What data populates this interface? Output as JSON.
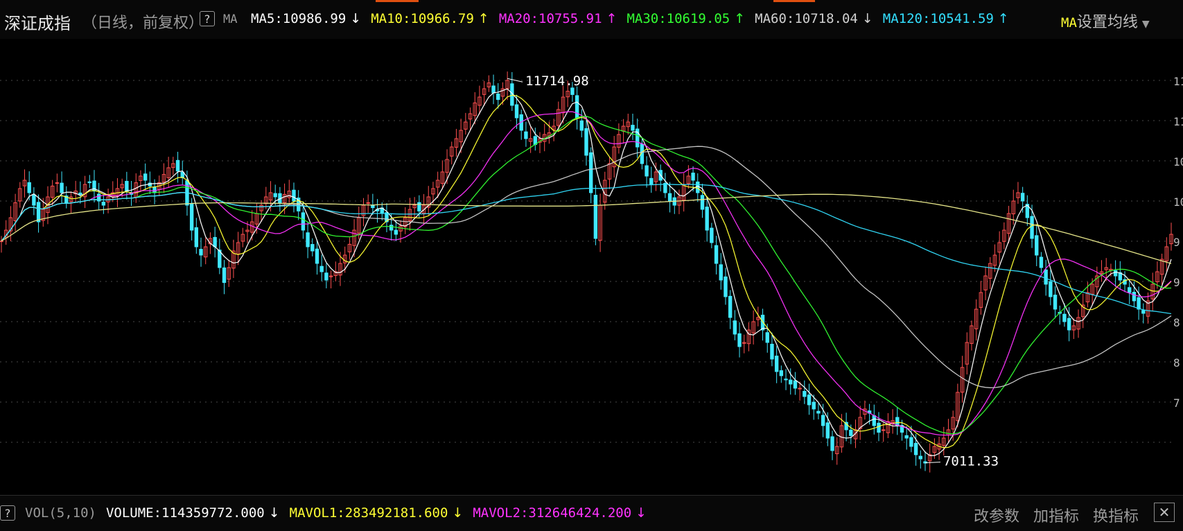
{
  "header": {
    "title": "深证成指",
    "subtitle": "（日线，前复权）",
    "help_label": "?",
    "indicator_name": "MA",
    "ma_items": [
      {
        "label": "MA5:10986.99",
        "arrow": "↓",
        "color": "#ffffff"
      },
      {
        "label": "MA10:10966.79",
        "arrow": "↑",
        "color": "#ffff33"
      },
      {
        "label": "MA20:10755.91",
        "arrow": "↑",
        "color": "#ff33ff"
      },
      {
        "label": "MA30:10619.05",
        "arrow": "↑",
        "color": "#33ff33"
      },
      {
        "label": "MA60:10718.04",
        "arrow": "↓",
        "color": "#cfcfcf"
      },
      {
        "label": "MA120:10541.59",
        "arrow": "↑",
        "color": "#33dfff"
      }
    ],
    "ma_settings_label": "设置均线",
    "ma_settings_prefix": "MA"
  },
  "chart_data": {
    "type": "candlestick",
    "y_range": [
      6900,
      11900
    ],
    "annotations": [
      {
        "label": "11714.98",
        "value": 11714.98,
        "kind": "high"
      },
      {
        "label": "7011.33",
        "value": 7011.33,
        "kind": "low"
      }
    ],
    "close": [
      9720,
      9850,
      10000,
      10180,
      10350,
      10450,
      10300,
      10150,
      9950,
      10100,
      10250,
      10380,
      10420,
      10300,
      10180,
      10250,
      10320,
      10280,
      10400,
      10420,
      10320,
      10200,
      10150,
      10250,
      10300,
      10350,
      10400,
      10320,
      10280,
      10420,
      10500,
      10450,
      10380,
      10300,
      10420,
      10520,
      10600,
      10650,
      10560,
      10480,
      10150,
      9850,
      9650,
      9550,
      9650,
      9750,
      9650,
      9400,
      9220,
      9400,
      9600,
      9700,
      9800,
      9850,
      9950,
      10050,
      10150,
      10250,
      10300,
      10250,
      10180,
      10280,
      10320,
      10200,
      10080,
      9850,
      9650,
      9600,
      9450,
      9350,
      9250,
      9300,
      9350,
      9450,
      9550,
      9680,
      9850,
      10000,
      10150,
      10180,
      10120,
      10080,
      10050,
      9950,
      9850,
      9800,
      9900,
      10000,
      10100,
      10150,
      10080,
      10150,
      10250,
      10350,
      10450,
      10550,
      10700,
      10850,
      10950,
      11050,
      11150,
      11250,
      11380,
      11450,
      11550,
      11620,
      11500,
      11420,
      11550,
      11650,
      11350,
      11200,
      11050,
      10950,
      10950,
      10880,
      10950,
      11000,
      11020,
      11100,
      11300,
      11450,
      11520,
      11480,
      11200,
      11050,
      10750,
      10300,
      9750,
      10150,
      10450,
      10650,
      10850,
      11000,
      11100,
      11150,
      11050,
      10850,
      10650,
      10500,
      10400,
      10550,
      10450,
      10300,
      10200,
      10150,
      10250,
      10400,
      10500,
      10450,
      10300,
      10100,
      9850,
      9700,
      9450,
      9250,
      9050,
      8800,
      8600,
      8450,
      8500,
      8650,
      8750,
      8800,
      8650,
      8500,
      8300,
      8150,
      8100,
      8050,
      8000,
      7950,
      7950,
      7850,
      7750,
      7700,
      7650,
      7500,
      7350,
      7200,
      7250,
      7500,
      7450,
      7380,
      7450,
      7600,
      7700,
      7650,
      7500,
      7420,
      7450,
      7550,
      7560,
      7500,
      7420,
      7350,
      7250,
      7150,
      7100,
      7050,
      7150,
      7250,
      7280,
      7350,
      7450,
      7600,
      7900,
      8200,
      8500,
      8700,
      8900,
      9100,
      9300,
      9450,
      9550,
      9700,
      9850,
      10050,
      10200,
      10300,
      10200,
      10000,
      9750,
      9550,
      9400,
      9200,
      9050,
      8900,
      8850,
      8750,
      8650,
      8700,
      8800,
      8950,
      9100,
      9200,
      9300,
      9350,
      9400,
      9380,
      9300,
      9250,
      9200,
      9100,
      9000,
      8900,
      8850,
      9000,
      9200,
      9350,
      9500,
      9650,
      9800
    ]
  },
  "volume": {
    "help_label": "?",
    "name": "VOL(5,10)",
    "items": [
      {
        "label": "VOLUME:114359772.000",
        "arrow": "↓",
        "color": "#ffffff"
      },
      {
        "label": "MAVOL1:283492181.600",
        "arrow": "↓",
        "color": "#ffff33"
      },
      {
        "label": "MAVOL2:312646424.200",
        "arrow": "↓",
        "color": "#ff33ff"
      }
    ],
    "actions": [
      "改参数",
      "加指标",
      "换指标"
    ],
    "close_label": "✕"
  }
}
